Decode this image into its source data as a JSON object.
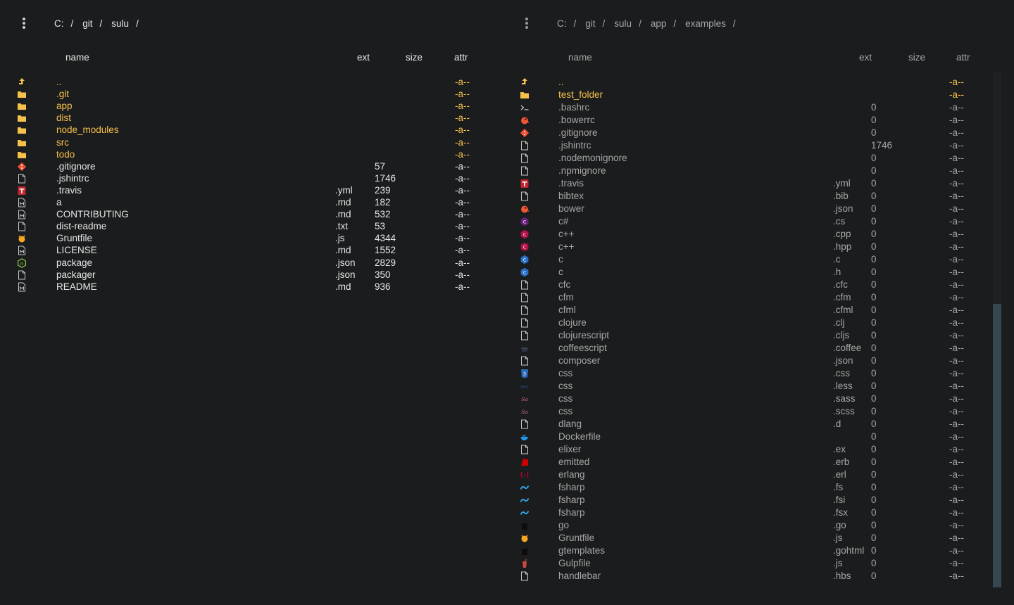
{
  "left": {
    "crumbs": [
      "C:",
      "git",
      "sulu"
    ],
    "separator": "/",
    "headers": {
      "name": "name",
      "ext": "ext",
      "size": "size",
      "attr": "attr"
    },
    "rows": [
      {
        "icon": "parent-folder-icon",
        "name": "..",
        "ext": "",
        "size": "",
        "attr": "-a--",
        "type": "dir"
      },
      {
        "icon": "folder-icon",
        "name": ".git",
        "ext": "",
        "size": "",
        "attr": "-a--",
        "type": "dir"
      },
      {
        "icon": "folder-icon",
        "name": "app",
        "ext": "",
        "size": "",
        "attr": "-a--",
        "type": "dir"
      },
      {
        "icon": "folder-icon",
        "name": "dist",
        "ext": "",
        "size": "",
        "attr": "-a--",
        "type": "dir"
      },
      {
        "icon": "folder-icon",
        "name": "node_modules",
        "ext": "",
        "size": "",
        "attr": "-a--",
        "type": "dir"
      },
      {
        "icon": "folder-icon",
        "name": "src",
        "ext": "",
        "size": "",
        "attr": "-a--",
        "type": "dir"
      },
      {
        "icon": "folder-icon",
        "name": "todo",
        "ext": "",
        "size": "",
        "attr": "-a--",
        "type": "dir"
      },
      {
        "icon": "git-icon",
        "name": ".gitignore",
        "ext": "",
        "size": "57",
        "attr": "-a--",
        "type": "file"
      },
      {
        "icon": "file-icon",
        "name": ".jshintrc",
        "ext": "",
        "size": "1746",
        "attr": "-a--",
        "type": "file"
      },
      {
        "icon": "travis-icon",
        "name": ".travis",
        "ext": ".yml",
        "size": "239",
        "attr": "-a--",
        "type": "file"
      },
      {
        "icon": "markdown-file-icon",
        "name": "a",
        "ext": ".md",
        "size": "182",
        "attr": "-a--",
        "type": "file"
      },
      {
        "icon": "markdown-file-icon",
        "name": "CONTRIBUTING",
        "ext": ".md",
        "size": "532",
        "attr": "-a--",
        "type": "file"
      },
      {
        "icon": "file-icon",
        "name": "dist-readme",
        "ext": ".txt",
        "size": "53",
        "attr": "-a--",
        "type": "file"
      },
      {
        "icon": "grunt-icon",
        "name": "Gruntfile",
        "ext": ".js",
        "size": "4344",
        "attr": "-a--",
        "type": "file"
      },
      {
        "icon": "markdown-file-icon",
        "name": "LICENSE",
        "ext": ".md",
        "size": "1552",
        "attr": "-a--",
        "type": "file"
      },
      {
        "icon": "nodejs-icon",
        "name": "package",
        "ext": ".json",
        "size": "2829",
        "attr": "-a--",
        "type": "file"
      },
      {
        "icon": "file-icon",
        "name": "packager",
        "ext": ".json",
        "size": "350",
        "attr": "-a--",
        "type": "file"
      },
      {
        "icon": "markdown-file-icon",
        "name": "README",
        "ext": ".md",
        "size": "936",
        "attr": "-a--",
        "type": "file"
      }
    ]
  },
  "right": {
    "crumbs": [
      "C:",
      "git",
      "sulu",
      "app",
      "examples"
    ],
    "separator": "/",
    "headers": {
      "name": "name",
      "ext": "ext",
      "size": "size",
      "attr": "attr"
    },
    "rows": [
      {
        "icon": "parent-folder-icon",
        "name": "..",
        "ext": "",
        "size": "",
        "attr": "-a--",
        "type": "dir"
      },
      {
        "icon": "folder-icon",
        "name": "test_folder",
        "ext": "",
        "size": "",
        "attr": "-a--",
        "type": "dir"
      },
      {
        "icon": "terminal-icon",
        "name": ".bashrc",
        "ext": "",
        "size": "0",
        "attr": "-a--",
        "type": "file"
      },
      {
        "icon": "bower-icon",
        "name": ".bowerrc",
        "ext": "",
        "size": "0",
        "attr": "-a--",
        "type": "file"
      },
      {
        "icon": "git-icon",
        "name": ".gitignore",
        "ext": "",
        "size": "0",
        "attr": "-a--",
        "type": "file"
      },
      {
        "icon": "file-icon",
        "name": ".jshintrc",
        "ext": "",
        "size": "1746",
        "attr": "-a--",
        "type": "file"
      },
      {
        "icon": "file-icon",
        "name": ".nodemonignore",
        "ext": "",
        "size": "0",
        "attr": "-a--",
        "type": "file"
      },
      {
        "icon": "file-icon",
        "name": ".npmignore",
        "ext": "",
        "size": "0",
        "attr": "-a--",
        "type": "file"
      },
      {
        "icon": "travis-icon",
        "name": ".travis",
        "ext": ".yml",
        "size": "0",
        "attr": "-a--",
        "type": "file"
      },
      {
        "icon": "file-icon",
        "name": "bibtex",
        "ext": ".bib",
        "size": "0",
        "attr": "-a--",
        "type": "file"
      },
      {
        "icon": "bower-icon",
        "name": "bower",
        "ext": ".json",
        "size": "0",
        "attr": "-a--",
        "type": "file"
      },
      {
        "icon": "csharp-icon",
        "name": "c#",
        "ext": ".cs",
        "size": "0",
        "attr": "-a--",
        "type": "file"
      },
      {
        "icon": "cpp-icon",
        "name": "c++",
        "ext": ".cpp",
        "size": "0",
        "attr": "-a--",
        "type": "file"
      },
      {
        "icon": "cpp-icon",
        "name": "c++",
        "ext": ".hpp",
        "size": "0",
        "attr": "-a--",
        "type": "file"
      },
      {
        "icon": "c-language-icon",
        "name": "c",
        "ext": ".c",
        "size": "0",
        "attr": "-a--",
        "type": "file"
      },
      {
        "icon": "c-language-icon",
        "name": "c",
        "ext": ".h",
        "size": "0",
        "attr": "-a--",
        "type": "file"
      },
      {
        "icon": "file-icon",
        "name": "cfc",
        "ext": ".cfc",
        "size": "0",
        "attr": "-a--",
        "type": "file"
      },
      {
        "icon": "file-icon",
        "name": "cfm",
        "ext": ".cfm",
        "size": "0",
        "attr": "-a--",
        "type": "file"
      },
      {
        "icon": "file-icon",
        "name": "cfml",
        "ext": ".cfml",
        "size": "0",
        "attr": "-a--",
        "type": "file"
      },
      {
        "icon": "file-icon",
        "name": "clojure",
        "ext": ".clj",
        "size": "0",
        "attr": "-a--",
        "type": "file"
      },
      {
        "icon": "file-icon",
        "name": "clojurescript",
        "ext": ".cljs",
        "size": "0",
        "attr": "-a--",
        "type": "file"
      },
      {
        "icon": "coffee-icon",
        "name": "coffeescript",
        "ext": ".coffee",
        "size": "0",
        "attr": "-a--",
        "type": "file"
      },
      {
        "icon": "file-icon",
        "name": "composer",
        "ext": ".json",
        "size": "0",
        "attr": "-a--",
        "type": "file"
      },
      {
        "icon": "css3-icon",
        "name": "css",
        "ext": ".css",
        "size": "0",
        "attr": "-a--",
        "type": "file"
      },
      {
        "icon": "less-icon",
        "name": "css",
        "ext": ".less",
        "size": "0",
        "attr": "-a--",
        "type": "file"
      },
      {
        "icon": "sass-icon",
        "name": "css",
        "ext": ".sass",
        "size": "0",
        "attr": "-a--",
        "type": "file"
      },
      {
        "icon": "sass-icon",
        "name": "css",
        "ext": ".scss",
        "size": "0",
        "attr": "-a--",
        "type": "file"
      },
      {
        "icon": "file-icon",
        "name": "dlang",
        "ext": ".d",
        "size": "0",
        "attr": "-a--",
        "type": "file"
      },
      {
        "icon": "docker-icon",
        "name": "Dockerfile",
        "ext": "",
        "size": "0",
        "attr": "-a--",
        "type": "file"
      },
      {
        "icon": "file-icon",
        "name": "elixer",
        "ext": ".ex",
        "size": "0",
        "attr": "-a--",
        "type": "file"
      },
      {
        "icon": "ruby-icon",
        "name": "emitted",
        "ext": ".erb",
        "size": "0",
        "attr": "-a--",
        "type": "file"
      },
      {
        "icon": "erlang-icon",
        "name": "erlang",
        "ext": ".erl",
        "size": "0",
        "attr": "-a--",
        "type": "file"
      },
      {
        "icon": "fsharp-icon",
        "name": "fsharp",
        "ext": ".fs",
        "size": "0",
        "attr": "-a--",
        "type": "file"
      },
      {
        "icon": "fsharp-icon",
        "name": "fsharp",
        "ext": ".fsi",
        "size": "0",
        "attr": "-a--",
        "type": "file"
      },
      {
        "icon": "fsharp-icon",
        "name": "fsharp",
        "ext": ".fsx",
        "size": "0",
        "attr": "-a--",
        "type": "file"
      },
      {
        "icon": "go-gopher-icon",
        "name": "go",
        "ext": ".go",
        "size": "0",
        "attr": "-a--",
        "type": "file"
      },
      {
        "icon": "grunt-icon",
        "name": "Gruntfile",
        "ext": ".js",
        "size": "0",
        "attr": "-a--",
        "type": "file"
      },
      {
        "icon": "go-gopher-icon",
        "name": "gtemplates",
        "ext": ".gohtml",
        "size": "0",
        "attr": "-a--",
        "type": "file"
      },
      {
        "icon": "gulp-icon",
        "name": "Gulpfile",
        "ext": ".js",
        "size": "0",
        "attr": "-a--",
        "type": "file"
      },
      {
        "icon": "file-icon",
        "name": "handlebar",
        "ext": ".hbs",
        "size": "0",
        "attr": "-a--",
        "type": "file"
      }
    ]
  },
  "colors": {
    "background": "#1b1c1d",
    "folder": "#f6c14b",
    "scrollbar_thumb": "#37474f"
  }
}
